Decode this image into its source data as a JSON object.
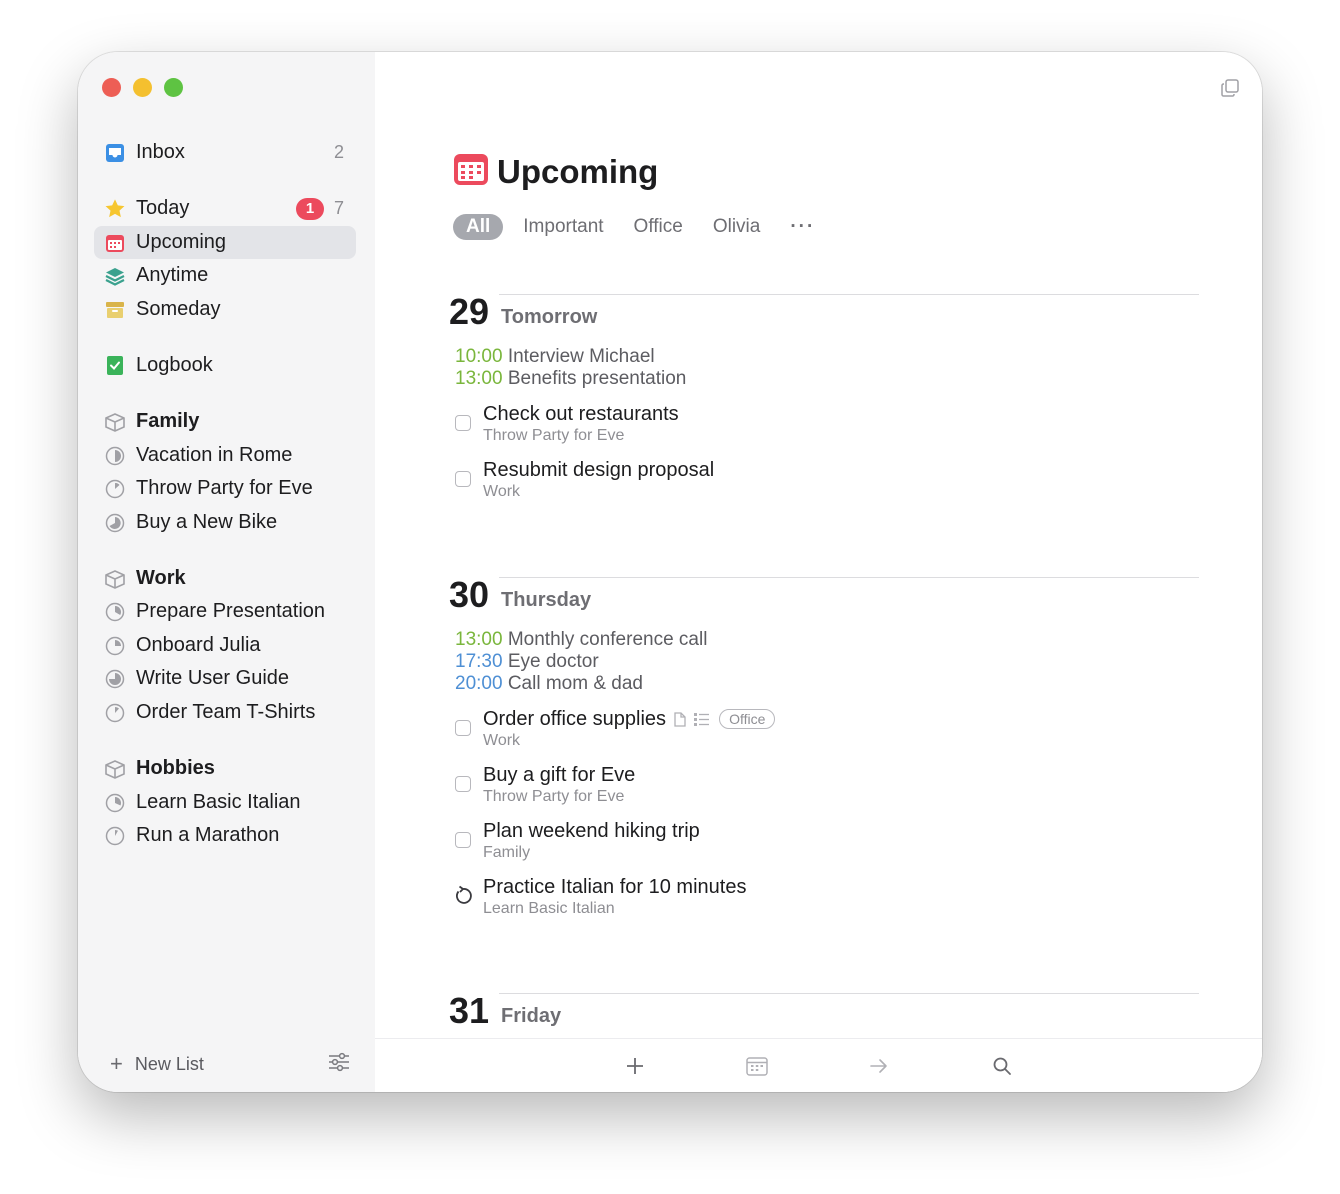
{
  "sidebar": {
    "inbox": {
      "label": "Inbox",
      "count": "2"
    },
    "today": {
      "label": "Today",
      "badge": "1",
      "count": "7"
    },
    "upcoming": {
      "label": "Upcoming"
    },
    "anytime": {
      "label": "Anytime"
    },
    "someday": {
      "label": "Someday"
    },
    "logbook": {
      "label": "Logbook"
    },
    "areas": [
      {
        "label": "Family",
        "projects": [
          "Vacation in Rome",
          "Throw Party for Eve",
          "Buy a New Bike"
        ]
      },
      {
        "label": "Work",
        "projects": [
          "Prepare Presentation",
          "Onboard Julia",
          "Write User Guide",
          "Order Team T-Shirts"
        ]
      },
      {
        "label": "Hobbies",
        "projects": [
          "Learn Basic Italian",
          "Run a Marathon"
        ]
      }
    ],
    "footer": {
      "plus": "+",
      "new_list": "New List"
    }
  },
  "main": {
    "title": "Upcoming",
    "tabs": [
      "All",
      "Important",
      "Office",
      "Olivia",
      "···"
    ],
    "days": [
      {
        "num": "29",
        "name": "Tomorrow",
        "events": [
          {
            "time": "10:00",
            "title": "Interview Michael"
          },
          {
            "time": "13:00",
            "title": "Benefits presentation"
          }
        ],
        "todos": [
          {
            "title": "Check out restaurants",
            "subtitle": "Throw Party for Eve"
          },
          {
            "title": "Resubmit design proposal",
            "subtitle": "Work"
          }
        ]
      },
      {
        "num": "30",
        "name": "Thursday",
        "events": [
          {
            "time": "13:00",
            "title": "Monthly conference call"
          },
          {
            "time": "17:30",
            "title": "Eye doctor"
          },
          {
            "time": "20:00",
            "title": "Call mom & dad"
          }
        ],
        "todos": [
          {
            "title": "Order office supplies",
            "subtitle": "Work",
            "tag": "Office"
          },
          {
            "title": "Buy a gift for Eve",
            "subtitle": "Throw Party for Eve"
          },
          {
            "title": "Plan weekend hiking trip",
            "subtitle": "Family"
          },
          {
            "title": "Practice Italian for 10 minutes",
            "subtitle": "Learn Basic Italian"
          }
        ]
      },
      {
        "num": "31",
        "name": "Friday"
      }
    ]
  },
  "colors": {
    "accent": "#ec4a5d",
    "event_green": "#7ab63c",
    "event_blue": "#4e8fd4",
    "selected_bg": "#e3e4e8"
  },
  "icons": {
    "toolbar": [
      "plus-icon",
      "calendar-icon",
      "arrow-right-icon",
      "search-icon"
    ]
  }
}
